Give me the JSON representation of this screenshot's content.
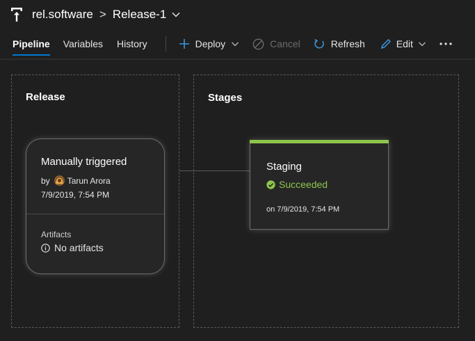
{
  "breadcrumb": {
    "icon": "pipeline-release-icon",
    "project": "rel.software",
    "separator": ">",
    "release": "Release-1"
  },
  "toolbar": {
    "tabs": [
      {
        "label": "Pipeline",
        "active": true
      },
      {
        "label": "Variables",
        "active": false
      },
      {
        "label": "History",
        "active": false
      }
    ],
    "deploy_label": "Deploy",
    "cancel_label": "Cancel",
    "refresh_label": "Refresh",
    "edit_label": "Edit",
    "more_label": "···"
  },
  "release_panel": {
    "title": "Release",
    "card": {
      "title": "Manually triggered",
      "by_prefix": "by",
      "author": "Tarun Arora",
      "date": "7/9/2019, 7:54 PM",
      "artifacts_label": "Artifacts",
      "artifacts_value": "No artifacts"
    }
  },
  "stages_panel": {
    "title": "Stages",
    "stage": {
      "name": "Staging",
      "status": "Succeeded",
      "date": "on 7/9/2019, 7:54 PM"
    }
  },
  "colors": {
    "background": "#1f1f1f",
    "accent": "#0078d4",
    "success": "#8dc54b",
    "icon_blue": "#3a96dd",
    "disabled": "#6d6d6d"
  }
}
